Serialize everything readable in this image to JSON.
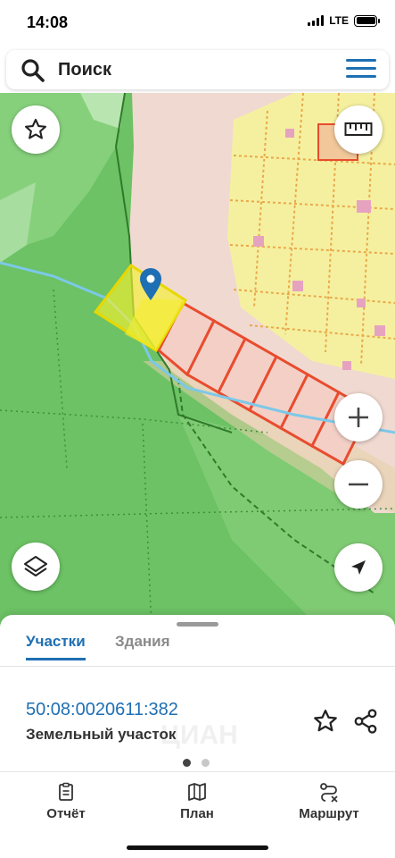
{
  "status_bar": {
    "time": "14:08",
    "network": "LTE"
  },
  "search": {
    "placeholder": "Поиск"
  },
  "map": {
    "icons": [
      "star-icon",
      "ruler-icon",
      "zoom-in-icon",
      "zoom-out-icon",
      "layers-icon",
      "navigation-arrow-icon",
      "location-pin-icon"
    ],
    "colors": {
      "forest": "#6cc264",
      "settlement": "#f0d9d0",
      "plots": "#f5f0a0",
      "boundary": "#e84c2e",
      "selected": "#f5ef2e",
      "accent": "#1e6fb3"
    }
  },
  "sheet": {
    "tabs": [
      {
        "label": "Участки",
        "active": true
      },
      {
        "label": "Здания",
        "active": false
      }
    ],
    "parcel": {
      "cadastral_number": "50:08:0020611:382",
      "type": "Земельный участок"
    },
    "watermark": "ЦИАН",
    "pager": {
      "count": 2,
      "active": 1
    }
  },
  "bottom_nav": {
    "items": [
      {
        "label": "Отчёт",
        "icon": "report-icon"
      },
      {
        "label": "План",
        "icon": "map-plan-icon"
      },
      {
        "label": "Маршрут",
        "icon": "route-icon"
      }
    ]
  }
}
